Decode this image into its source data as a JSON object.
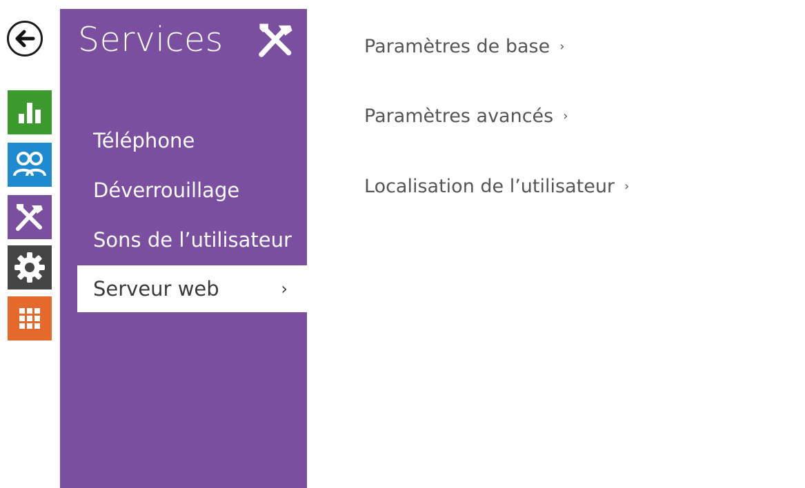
{
  "rail": {
    "back_icon": "arrow-left-icon",
    "tiles": [
      {
        "name": "status",
        "icon": "bar-chart-icon",
        "color": "#3a9a2c"
      },
      {
        "name": "users",
        "icon": "users-icon",
        "color": "#1e8bd0"
      },
      {
        "name": "services",
        "icon": "tools-icon",
        "color": "#7b4fa0"
      },
      {
        "name": "settings",
        "icon": "gear-icon",
        "color": "#454545"
      },
      {
        "name": "apps",
        "icon": "grid-icon",
        "color": "#e4692a"
      }
    ]
  },
  "panel": {
    "title": "Services",
    "icon": "tools-icon",
    "accent": "#7b4fa0",
    "items": [
      {
        "label": "Téléphone"
      },
      {
        "label": "Déverrouillage"
      },
      {
        "label": "Sons de l’utilisateur"
      },
      {
        "label": "Serveur web",
        "chevron": "›",
        "active": true
      }
    ]
  },
  "content": {
    "links": [
      {
        "label": "Paramètres de base",
        "chevron": "›"
      },
      {
        "label": "Paramètres avancés",
        "chevron": "›"
      },
      {
        "label": "Localisation de l’utilisateur",
        "chevron": "›"
      }
    ]
  }
}
